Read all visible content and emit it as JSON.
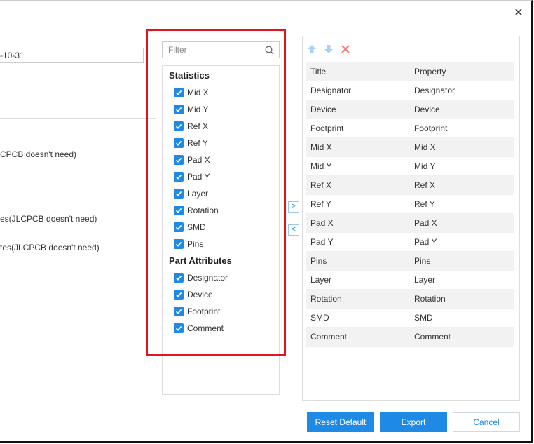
{
  "dialog": {
    "close_icon": "close-icon",
    "date_value": "-10-31",
    "left_notes": [
      "CPCB doesn't need)",
      "es(JLCPCB doesn't need)",
      "tes(JLCPCB doesn't need)"
    ]
  },
  "center": {
    "filter_placeholder": "Filter",
    "search_icon": "search-icon",
    "groups": [
      {
        "title": "Statistics",
        "items": [
          "Mid X",
          "Mid Y",
          "Ref X",
          "Ref Y",
          "Pad X",
          "Pad Y",
          "Layer",
          "Rotation",
          "SMD",
          "Pins"
        ]
      },
      {
        "title": "Part Attributes",
        "items": [
          "Designator",
          "Device",
          "Footprint",
          "Comment"
        ]
      }
    ]
  },
  "transfer": {
    "right_arrow": ">",
    "left_arrow": "<"
  },
  "toolbar": {
    "icons": [
      "arrow-up-icon",
      "arrow-down-icon",
      "delete-icon"
    ]
  },
  "table": {
    "headers": [
      "Title",
      "Property"
    ],
    "rows": [
      [
        "Designator",
        "Designator"
      ],
      [
        "Device",
        "Device"
      ],
      [
        "Footprint",
        "Footprint"
      ],
      [
        "Mid X",
        "Mid X"
      ],
      [
        "Mid Y",
        "Mid Y"
      ],
      [
        "Ref X",
        "Ref X"
      ],
      [
        "Ref Y",
        "Ref Y"
      ],
      [
        "Pad X",
        "Pad X"
      ],
      [
        "Pad Y",
        "Pad Y"
      ],
      [
        "Pins",
        "Pins"
      ],
      [
        "Layer",
        "Layer"
      ],
      [
        "Rotation",
        "Rotation"
      ],
      [
        "SMD",
        "SMD"
      ],
      [
        "Comment",
        "Comment"
      ]
    ]
  },
  "footer": {
    "reset_label": "Reset Default",
    "export_label": "Export",
    "cancel_label": "Cancel"
  },
  "colors": {
    "accent": "#1e8ae6",
    "highlight": "#e0151f",
    "delete": "#f47c7c",
    "arrow_disabled": "#a9d0f5"
  }
}
